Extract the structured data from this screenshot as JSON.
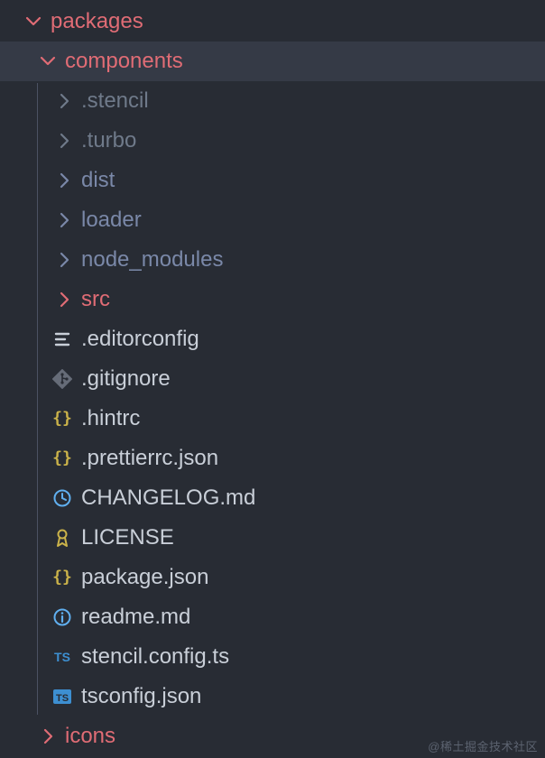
{
  "tree": {
    "packages": {
      "label": "packages",
      "expanded": true
    },
    "components": {
      "label": "components",
      "expanded": true,
      "selected": true
    },
    "folders": [
      {
        "label": ".stencil",
        "color": "grey"
      },
      {
        "label": ".turbo",
        "color": "grey"
      },
      {
        "label": "dist",
        "color": "lblue"
      },
      {
        "label": "loader",
        "color": "lblue"
      },
      {
        "label": "node_modules",
        "color": "lblue"
      },
      {
        "label": "src",
        "color": "red"
      }
    ],
    "files": [
      {
        "label": ".editorconfig",
        "icon": "editorconfig"
      },
      {
        "label": ".gitignore",
        "icon": "git"
      },
      {
        "label": ".hintrc",
        "icon": "json"
      },
      {
        "label": ".prettierrc.json",
        "icon": "json"
      },
      {
        "label": "CHANGELOG.md",
        "icon": "clock"
      },
      {
        "label": "LICENSE",
        "icon": "license"
      },
      {
        "label": "package.json",
        "icon": "json"
      },
      {
        "label": "readme.md",
        "icon": "info"
      },
      {
        "label": "stencil.config.ts",
        "icon": "ts"
      },
      {
        "label": "tsconfig.json",
        "icon": "tsconfig"
      }
    ],
    "icons": {
      "label": "icons",
      "expanded": false
    }
  },
  "watermark": "@稀土掘金技术社区"
}
